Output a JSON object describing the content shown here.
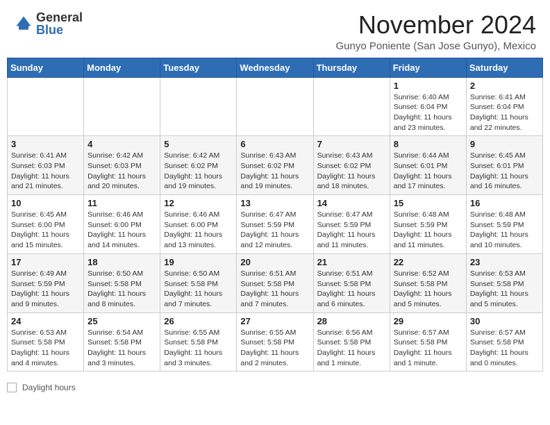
{
  "header": {
    "logo_general": "General",
    "logo_blue": "Blue",
    "month_title": "November 2024",
    "location": "Gunyo Poniente (San Jose Gunyo), Mexico"
  },
  "footer": {
    "daylight_label": "Daylight hours"
  },
  "weekdays": [
    "Sunday",
    "Monday",
    "Tuesday",
    "Wednesday",
    "Thursday",
    "Friday",
    "Saturday"
  ],
  "weeks": [
    [
      {
        "day": "",
        "info": ""
      },
      {
        "day": "",
        "info": ""
      },
      {
        "day": "",
        "info": ""
      },
      {
        "day": "",
        "info": ""
      },
      {
        "day": "",
        "info": ""
      },
      {
        "day": "1",
        "info": "Sunrise: 6:40 AM\nSunset: 6:04 PM\nDaylight: 11 hours and 23 minutes."
      },
      {
        "day": "2",
        "info": "Sunrise: 6:41 AM\nSunset: 6:04 PM\nDaylight: 11 hours and 22 minutes."
      }
    ],
    [
      {
        "day": "3",
        "info": "Sunrise: 6:41 AM\nSunset: 6:03 PM\nDaylight: 11 hours and 21 minutes."
      },
      {
        "day": "4",
        "info": "Sunrise: 6:42 AM\nSunset: 6:03 PM\nDaylight: 11 hours and 20 minutes."
      },
      {
        "day": "5",
        "info": "Sunrise: 6:42 AM\nSunset: 6:02 PM\nDaylight: 11 hours and 19 minutes."
      },
      {
        "day": "6",
        "info": "Sunrise: 6:43 AM\nSunset: 6:02 PM\nDaylight: 11 hours and 19 minutes."
      },
      {
        "day": "7",
        "info": "Sunrise: 6:43 AM\nSunset: 6:02 PM\nDaylight: 11 hours and 18 minutes."
      },
      {
        "day": "8",
        "info": "Sunrise: 6:44 AM\nSunset: 6:01 PM\nDaylight: 11 hours and 17 minutes."
      },
      {
        "day": "9",
        "info": "Sunrise: 6:45 AM\nSunset: 6:01 PM\nDaylight: 11 hours and 16 minutes."
      }
    ],
    [
      {
        "day": "10",
        "info": "Sunrise: 6:45 AM\nSunset: 6:00 PM\nDaylight: 11 hours and 15 minutes."
      },
      {
        "day": "11",
        "info": "Sunrise: 6:46 AM\nSunset: 6:00 PM\nDaylight: 11 hours and 14 minutes."
      },
      {
        "day": "12",
        "info": "Sunrise: 6:46 AM\nSunset: 6:00 PM\nDaylight: 11 hours and 13 minutes."
      },
      {
        "day": "13",
        "info": "Sunrise: 6:47 AM\nSunset: 5:59 PM\nDaylight: 11 hours and 12 minutes."
      },
      {
        "day": "14",
        "info": "Sunrise: 6:47 AM\nSunset: 5:59 PM\nDaylight: 11 hours and 11 minutes."
      },
      {
        "day": "15",
        "info": "Sunrise: 6:48 AM\nSunset: 5:59 PM\nDaylight: 11 hours and 11 minutes."
      },
      {
        "day": "16",
        "info": "Sunrise: 6:48 AM\nSunset: 5:59 PM\nDaylight: 11 hours and 10 minutes."
      }
    ],
    [
      {
        "day": "17",
        "info": "Sunrise: 6:49 AM\nSunset: 5:59 PM\nDaylight: 11 hours and 9 minutes."
      },
      {
        "day": "18",
        "info": "Sunrise: 6:50 AM\nSunset: 5:58 PM\nDaylight: 11 hours and 8 minutes."
      },
      {
        "day": "19",
        "info": "Sunrise: 6:50 AM\nSunset: 5:58 PM\nDaylight: 11 hours and 7 minutes."
      },
      {
        "day": "20",
        "info": "Sunrise: 6:51 AM\nSunset: 5:58 PM\nDaylight: 11 hours and 7 minutes."
      },
      {
        "day": "21",
        "info": "Sunrise: 6:51 AM\nSunset: 5:58 PM\nDaylight: 11 hours and 6 minutes."
      },
      {
        "day": "22",
        "info": "Sunrise: 6:52 AM\nSunset: 5:58 PM\nDaylight: 11 hours and 5 minutes."
      },
      {
        "day": "23",
        "info": "Sunrise: 6:53 AM\nSunset: 5:58 PM\nDaylight: 11 hours and 5 minutes."
      }
    ],
    [
      {
        "day": "24",
        "info": "Sunrise: 6:53 AM\nSunset: 5:58 PM\nDaylight: 11 hours and 4 minutes."
      },
      {
        "day": "25",
        "info": "Sunrise: 6:54 AM\nSunset: 5:58 PM\nDaylight: 11 hours and 3 minutes."
      },
      {
        "day": "26",
        "info": "Sunrise: 6:55 AM\nSunset: 5:58 PM\nDaylight: 11 hours and 3 minutes."
      },
      {
        "day": "27",
        "info": "Sunrise: 6:55 AM\nSunset: 5:58 PM\nDaylight: 11 hours and 2 minutes."
      },
      {
        "day": "28",
        "info": "Sunrise: 6:56 AM\nSunset: 5:58 PM\nDaylight: 11 hours and 1 minute."
      },
      {
        "day": "29",
        "info": "Sunrise: 6:57 AM\nSunset: 5:58 PM\nDaylight: 11 hours and 1 minute."
      },
      {
        "day": "30",
        "info": "Sunrise: 6:57 AM\nSunset: 5:58 PM\nDaylight: 11 hours and 0 minutes."
      }
    ]
  ]
}
